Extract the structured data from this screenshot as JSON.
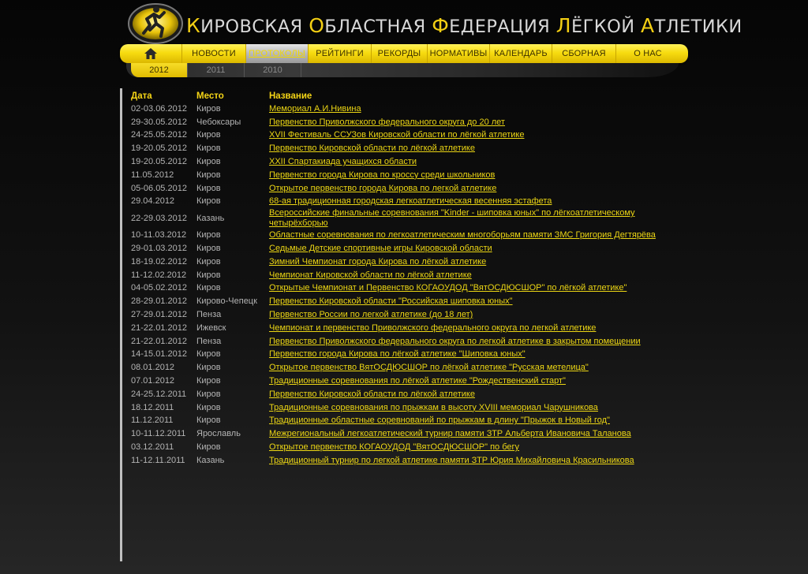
{
  "header": {
    "title": "Кировская областная федерация лёгкой атлетики",
    "title_words": [
      "Кировская",
      "областная",
      "федерация",
      "лёгкой",
      "атлетики"
    ]
  },
  "nav": {
    "home_icon": "home-icon",
    "items": [
      {
        "id": "news",
        "label": "НОВОСТИ",
        "width": 81
      },
      {
        "id": "protocols",
        "label": "ПРОТОКОЛЫ",
        "width": 79,
        "active": true
      },
      {
        "id": "ratings",
        "label": "РЕЙТИНГИ",
        "width": 80
      },
      {
        "id": "records",
        "label": "РЕКОРДЫ",
        "width": 71
      },
      {
        "id": "standards",
        "label": "НОРМАТИВЫ",
        "width": 79
      },
      {
        "id": "calendar",
        "label": "КАЛЕНДАРЬ",
        "width": 79
      },
      {
        "id": "team",
        "label": "СБОРНАЯ",
        "width": 81
      },
      {
        "id": "about",
        "label": "О НАС",
        "width": 80
      }
    ]
  },
  "years": [
    {
      "label": "2012",
      "active": true
    },
    {
      "label": "2011",
      "active": false
    },
    {
      "label": "2010",
      "active": false
    }
  ],
  "table": {
    "headers": {
      "date": "Дата",
      "place": "Место",
      "name": "Название"
    },
    "rows": [
      {
        "date": "02-03.06.2012",
        "place": "Киров",
        "name": "Мемориал А.И.Нивина"
      },
      {
        "date": "29-30.05.2012",
        "place": "Чебоксары",
        "name": "Первенство Приволжского федерального округа до 20 лет"
      },
      {
        "date": "24-25.05.2012",
        "place": "Киров",
        "name": "XVII Фестиваль ССУЗов Кировской области по лёгкой атлетике"
      },
      {
        "date": "19-20.05.2012",
        "place": "Киров",
        "name": "Первенство Кировской области по лёгкой атлетике"
      },
      {
        "date": "19-20.05.2012",
        "place": "Киров",
        "name": "XXII Спартакиада учащихся области"
      },
      {
        "date": "11.05.2012",
        "place": "Киров",
        "name": "Первенство города Кирова по кроссу среди школьников"
      },
      {
        "date": "05-06.05.2012",
        "place": "Киров",
        "name": "Открытое первенство города Кирова по легкой атлетике"
      },
      {
        "date": "29.04.2012",
        "place": "Киров",
        "name": "68-ая традиционная городская легкоатлетическая весенняя эстафета"
      },
      {
        "date": "22-29.03.2012",
        "place": "Казань",
        "name": "Всероссийские финальные соревнования \"Kinder - шиповка юных\" по лёгкоатлетическому четырёхборью"
      },
      {
        "date": "10-11.03.2012",
        "place": "Киров",
        "name": "Областные соревнования по легкоатлетическим многоборьям памяти ЗМС Григория Дегтярёва"
      },
      {
        "date": "29-01.03.2012",
        "place": "Киров",
        "name": "Седьмые Детские спортивные игры Кировской области"
      },
      {
        "date": "18-19.02.2012",
        "place": "Киров",
        "name": "Зимний Чемпионат города Кирова по лёгкой атлетике"
      },
      {
        "date": "11-12.02.2012",
        "place": "Киров",
        "name": "Чемпионат Кировской области по лёгкой атлетике"
      },
      {
        "date": "04-05.02.2012",
        "place": "Киров",
        "name": "Открытые Чемпионат и Первенство КОГАОУДОД \"ВятОСДЮСШОР\" по лёгкой атлетике\""
      },
      {
        "date": "28-29.01.2012",
        "place": "Кирово-Чепецк",
        "name": "Первенство Кировской области \"Российская шиповка юных\""
      },
      {
        "date": "27-29.01.2012",
        "place": "Пенза",
        "name": "Первенство России по легкой атлетике (до 18 лет)"
      },
      {
        "date": "21-22.01.2012",
        "place": "Ижевск",
        "name": "Чемпионат и первенство Приволжского федерального округа по легкой атлетике"
      },
      {
        "date": "21-22.01.2012",
        "place": "Пенза",
        "name": "Первенство Приволжского федерального округа по легкой атлетике в закрытом помещении"
      },
      {
        "date": "14-15.01.2012",
        "place": "Киров",
        "name": "Первенство города Кирова по лёгкой атлетике \"Шиповка юных\""
      },
      {
        "date": "08.01.2012",
        "place": "Киров",
        "name": "Открытое первенство ВятОСДЮСШОР по лёгкой атлетике \"Русская метелица\""
      },
      {
        "date": "07.01.2012",
        "place": "Киров",
        "name": "Традиционные соревнования по лёгкой атлетике \"Рождественский старт\""
      },
      {
        "date": "24-25.12.2011",
        "place": "Киров",
        "name": "Первенство Кировской области по лёгкой атлетике"
      },
      {
        "date": "18.12.2011",
        "place": "Киров",
        "name": "Традиционные соревнования по прыжкам в высоту XVIII мемориал Чарушникова"
      },
      {
        "date": "11.12.2011",
        "place": "Киров",
        "name": "Традиционные областные соревнований по прыжкам в длину \"Прыжок в Новый год\""
      },
      {
        "date": "10-11.12.2011",
        "place": "Ярославль",
        "name": "Межрегиональный легкоатлетический турнир памяти ЗТР Альберта Ивановича Таланова"
      },
      {
        "date": "03.12.2011",
        "place": "Киров",
        "name": "Открытое первенство КОГАОУДОД \"ВятОСДЮСШОР\" по бегу"
      },
      {
        "date": "11-12.11.2011",
        "place": "Казань",
        "name": "Традиционный турнир по легкой атлетике памяти ЗТР Юрия Михайловича Красильникова"
      }
    ]
  },
  "colors": {
    "accent_yellow": "#f3cf14",
    "link_yellow": "#ecd614",
    "text_gray": "#b4b4b4",
    "background": "#0a0a0a"
  }
}
